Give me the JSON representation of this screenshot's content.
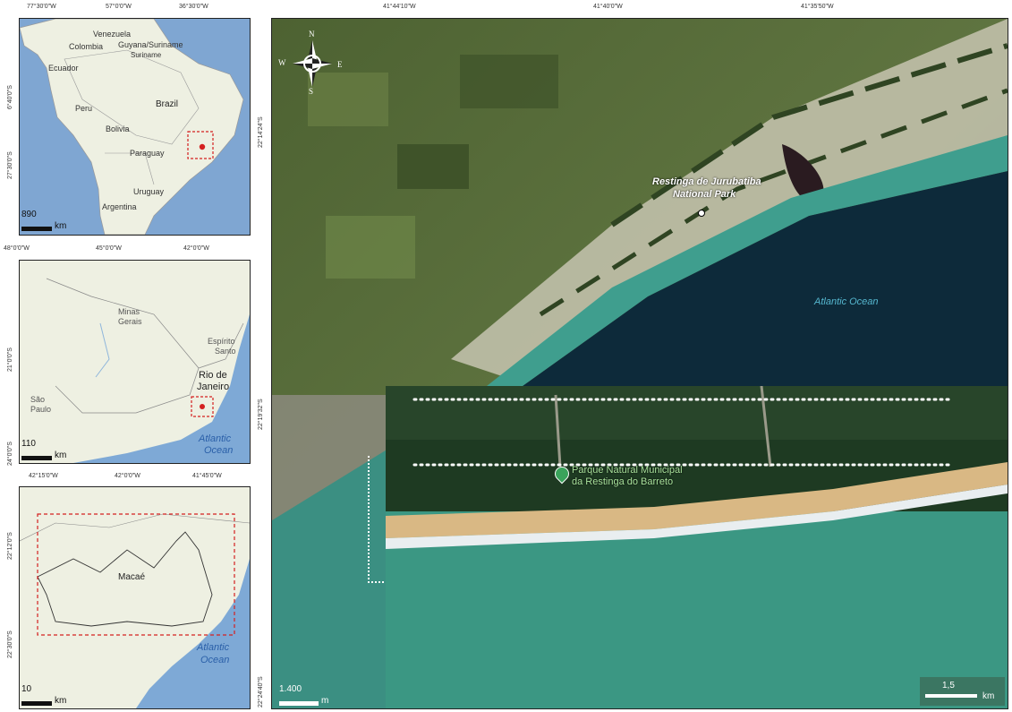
{
  "panel1": {
    "top_ticks": [
      "77°30'0\"W",
      "57°0'0\"W",
      "36°30'0\"W"
    ],
    "side_ticks": [
      "6°40'0\"S",
      "27°30'0\"S"
    ],
    "labels": {
      "venezuela": "Venezuela",
      "guyana": "Guyana/Suriname",
      "colombia": "Colombia",
      "suriname": "Suriname",
      "ecuador": "Ecuador",
      "brazil": "Brazil",
      "peru": "Peru",
      "bolivia": "Bolivia",
      "paraguay": "Paraguay",
      "uruguay": "Uruguay",
      "argentina": "Argentina"
    },
    "scale_value": "890",
    "scale_unit": "km"
  },
  "panel2": {
    "top_ticks": [
      "48°0'0\"W",
      "45°0'0\"W",
      "42°0'0\"W"
    ],
    "side_ticks": [
      "21°0'0\"S",
      "24°0'0\"S"
    ],
    "labels": {
      "minas1": "Minas",
      "minas2": "Gerais",
      "es1": "Espírito",
      "es2": "Santo",
      "rj1": "Rio de",
      "rj2": "Janeiro",
      "sp1": "São",
      "sp2": "Paulo",
      "ocean1": "Atlantic",
      "ocean2": "Ocean"
    },
    "scale_value": "110",
    "scale_unit": "km"
  },
  "panel3": {
    "top_ticks": [
      "42°15'0\"W",
      "42°0'0\"W",
      "41°45'0\"W"
    ],
    "side_ticks": [
      "22°12'0\"S",
      "22°30'0\"S"
    ],
    "labels": {
      "macae": "Macaé",
      "ocean1": "Atlantic",
      "ocean2": "Ocean"
    },
    "scale_value": "10",
    "scale_unit": "km"
  },
  "main": {
    "top_ticks": [
      "41°44'10\"W",
      "41°40'0\"W",
      "41°35'50\"W"
    ],
    "side_ticks": [
      "22°14'24\"S",
      "22°19'32\"S",
      "22°24'40\"S"
    ],
    "park_label_1": "Restinga de Jurubatiba",
    "park_label_2": "National Park",
    "ocean_label": "Atlantic Ocean",
    "compass": {
      "n": "N",
      "s": "S",
      "e": "E",
      "w": "W"
    },
    "scale_value": "1.400",
    "scale_unit": "m"
  },
  "inset": {
    "poi_label_1": "Parque Natural Municipal",
    "poi_label_2": "da Restinga do Barreto",
    "scale_value": "1,5",
    "scale_unit": "km"
  },
  "colors": {
    "ocean_deep": "#0d2a3a",
    "ocean_shallow": "#3f9e8e",
    "land_map": "#ecefe0",
    "water_map": "#7ea9d6",
    "frame_red": "#d42020"
  }
}
